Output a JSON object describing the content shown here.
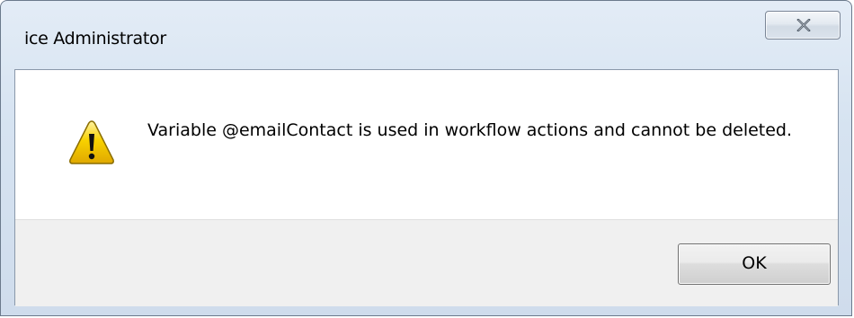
{
  "window": {
    "title": "ice Administrator"
  },
  "titlebar": {
    "close_icon": "close-icon"
  },
  "dialog": {
    "icon": "warning-icon",
    "message": "Variable @emailContact is used in workflow actions and cannot be deleted.",
    "ok_label": "OK"
  },
  "colors": {
    "warning_fill": "#f5c400",
    "warning_border": "#8a6d00",
    "titlebar": "#d6e3f1"
  }
}
